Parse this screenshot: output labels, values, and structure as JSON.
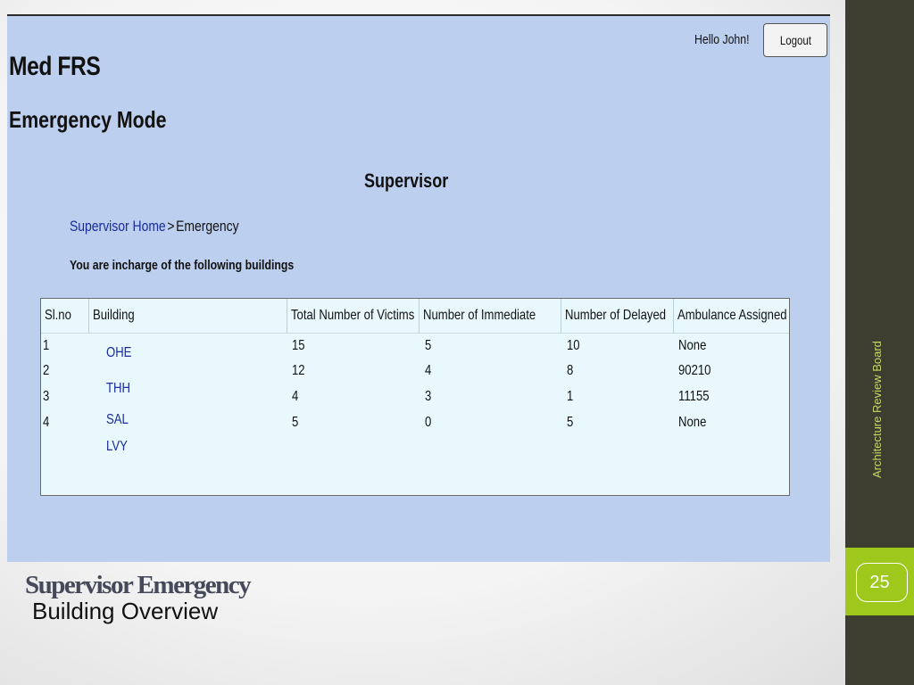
{
  "app": {
    "greeting": "Hello John!",
    "logout_label": "Logout",
    "title": "Med FRS",
    "mode": "Emergency Mode",
    "role": "Supervisor"
  },
  "breadcrumb": {
    "home": "Supervisor Home",
    "separator": ">",
    "current": "Emergency"
  },
  "intro_text": "You are incharge of the following buildings",
  "table": {
    "headers": [
      "Sl.no",
      "Building",
      "Total Number of Victims",
      "Number of Immediate",
      "Number of Delayed",
      "Ambulance Assigned"
    ],
    "serials": [
      "1",
      "2",
      "3",
      "4"
    ],
    "buildings": [
      "OHE",
      "THH",
      "SAL",
      "LVY"
    ],
    "victims": [
      "15",
      "12",
      "4",
      "5"
    ],
    "immediate": [
      "5",
      "4",
      "3",
      "0"
    ],
    "delayed": [
      "10",
      "8",
      "1",
      "5"
    ],
    "ambulance": [
      "None",
      "90210",
      "11155",
      "None"
    ]
  },
  "slide": {
    "title": "Supervisor Emergency",
    "subtitle": "Building Overview",
    "side_label": "Architecture Review Board",
    "page_number": "25"
  },
  "colors": {
    "app_background": "#bccfee",
    "table_background": "#e8f8fd",
    "link": "#1a2b9c",
    "side_panel": "#3d3e2f",
    "accent": "#9ec81c"
  }
}
